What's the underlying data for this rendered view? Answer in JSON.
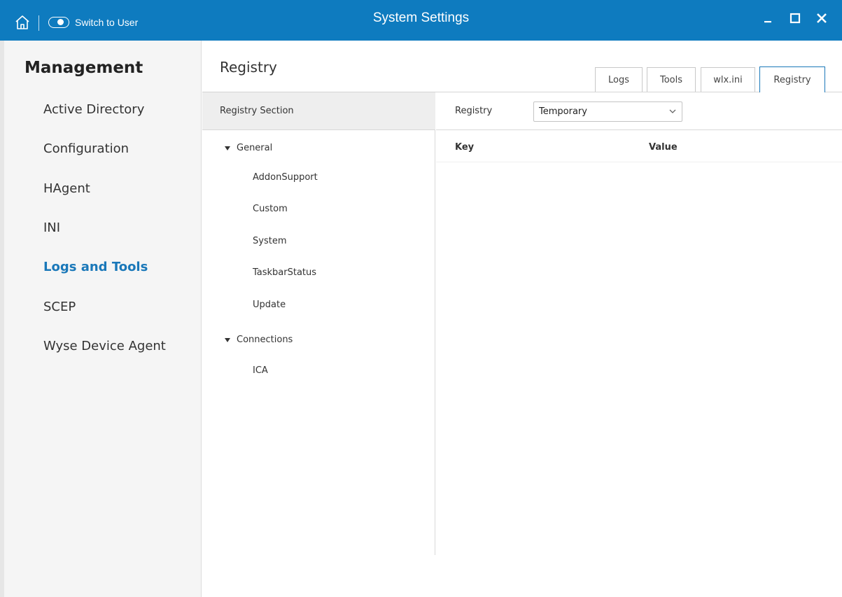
{
  "titlebar": {
    "switch_label": "Switch to User",
    "title": "System Settings"
  },
  "sidebar": {
    "title": "Management",
    "items": [
      {
        "label": "Active Directory",
        "active": false
      },
      {
        "label": "Configuration",
        "active": false
      },
      {
        "label": "HAgent",
        "active": false
      },
      {
        "label": "INI",
        "active": false
      },
      {
        "label": "Logs and Tools",
        "active": true
      },
      {
        "label": "SCEP",
        "active": false
      },
      {
        "label": "Wyse Device Agent",
        "active": false
      }
    ]
  },
  "main": {
    "title": "Registry",
    "tabs": [
      {
        "label": "Logs",
        "active": false
      },
      {
        "label": "Tools",
        "active": false
      },
      {
        "label": "wlx.ini",
        "active": false
      },
      {
        "label": "Registry",
        "active": true
      }
    ],
    "registry_section": {
      "header": "Registry Section",
      "groups": [
        {
          "label": "General",
          "expanded": true,
          "items": [
            "AddonSupport",
            "Custom",
            "System",
            "TaskbarStatus",
            "Update"
          ]
        },
        {
          "label": "Connections",
          "expanded": true,
          "items": [
            "ICA"
          ]
        }
      ]
    },
    "registry": {
      "label": "Registry",
      "selected": "Temporary",
      "columns": {
        "key": "Key",
        "value": "Value"
      }
    }
  },
  "icons": {
    "home": "home-icon",
    "toggle": "toggle-icon",
    "minimize": "minimize-icon",
    "maximize": "maximize-icon",
    "close": "close-icon",
    "caret": "caret-down-icon",
    "select_chevron": "chevron-down-icon"
  },
  "colors": {
    "titlebar": "#0e7bbf",
    "accent": "#1a78b9",
    "sidebar_bg": "#f5f5f5",
    "section_header_bg": "#eeeeee"
  }
}
